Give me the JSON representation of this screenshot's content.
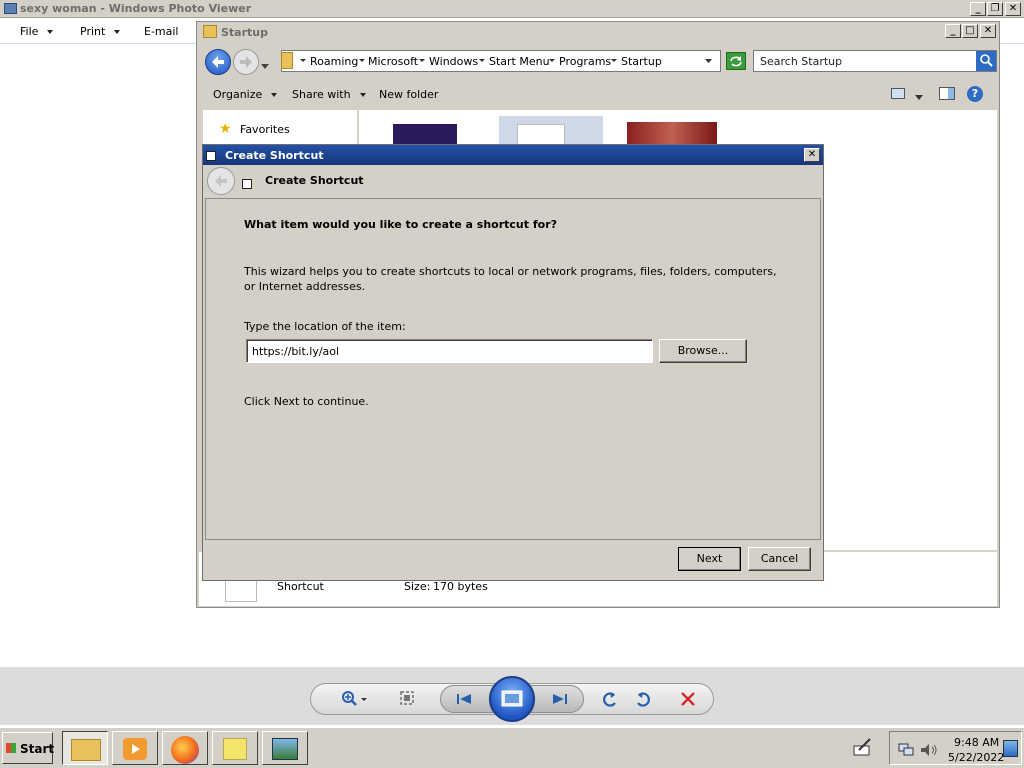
{
  "photo_viewer": {
    "title": "sexy woman - Windows Photo Viewer",
    "menu": {
      "file": "File",
      "print": "Print",
      "email": "E-mail"
    }
  },
  "explorer": {
    "title": "Startup",
    "breadcrumbs": [
      "Roaming",
      "Microsoft",
      "Windows",
      "Start Menu",
      "Programs",
      "Startup"
    ],
    "search_placeholder": "Search Startup",
    "toolbar": {
      "organize": "Organize",
      "share_with": "Share with",
      "new_folder": "New folder"
    },
    "nav": {
      "favorites": "Favorites"
    },
    "details": {
      "type": "Shortcut",
      "size_label": "Size:",
      "size_value": "170 bytes"
    }
  },
  "dialog": {
    "title": "Create Shortcut",
    "header": "Create Shortcut",
    "question": "What item would you like to create a shortcut for?",
    "description": "This wizard helps you to create shortcuts to local or network programs, files, folders, computers, or Internet addresses.",
    "location_label": "Type the location of the item:",
    "location_value": "https://bit.ly/aol",
    "browse_label": "Browse...",
    "continue_text": "Click Next to continue.",
    "next_label": "Next",
    "cancel_label": "Cancel"
  },
  "taskbar": {
    "start_label": "Start",
    "time": "9:48 AM",
    "date": "5/22/2022"
  },
  "colors": {
    "dialog_title_bar": "#17357a",
    "window_face": "#d4d0c8",
    "nav_back_blue": "#2d6bc4",
    "delete_red": "#d02a2a"
  }
}
